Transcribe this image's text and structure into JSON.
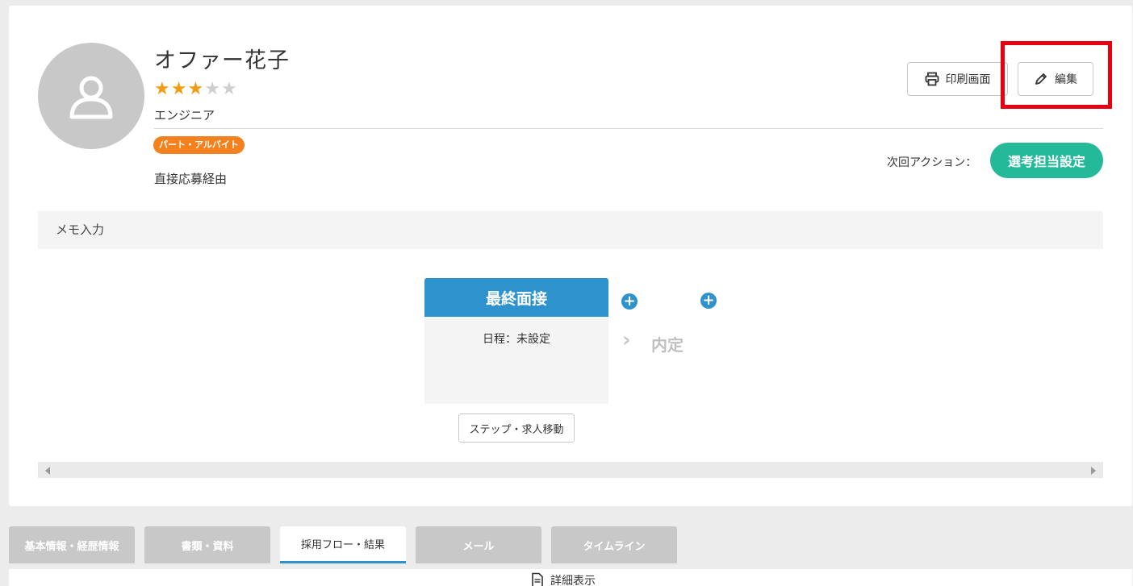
{
  "profile": {
    "name": "オファー花子",
    "rating": 3,
    "rating_max": 5,
    "job_title": "エンジニア",
    "employment_tag": "パート・アルバイト",
    "source": "直接応募経由",
    "avatar_icon": "user-avatar-icon"
  },
  "header_actions": {
    "print_label": "印刷画面",
    "print_icon": "printer-icon",
    "edit_label": "編集",
    "edit_icon": "pencil-icon"
  },
  "next_action": {
    "label": "次回アクション：",
    "button_label": "選考担当設定"
  },
  "memo": {
    "label": "メモ入力"
  },
  "flow": {
    "current_step": "最終面接",
    "schedule": "日程：未設定",
    "next_step": "内定",
    "move_button": "ステップ・求人移動"
  },
  "tabs": [
    {
      "label": "基本情報・経歴情報",
      "active": false
    },
    {
      "label": "書類・資料",
      "active": false
    },
    {
      "label": "採用フロー・結果",
      "active": true
    },
    {
      "label": "メール",
      "active": false
    },
    {
      "label": "タイムライン",
      "active": false
    }
  ],
  "detail": {
    "label": "詳細表示",
    "icon": "document-icon"
  },
  "colors": {
    "accent_blue": "#2e92cd",
    "green": "#23b999",
    "orange_tag": "#f3811e",
    "star": "#f39c12",
    "highlight_red": "#e60012"
  }
}
